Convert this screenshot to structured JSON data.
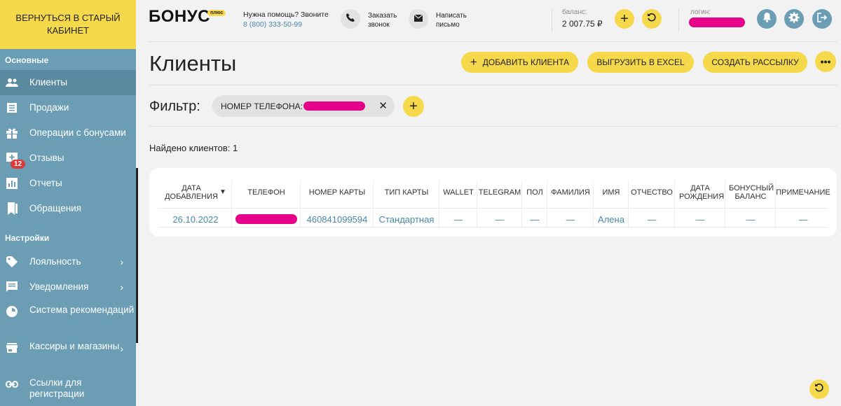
{
  "sidebar": {
    "back_button": "ВЕРНУТЬСЯ В СТАРЫЙ КАБИНЕТ",
    "section_main": "Основные",
    "section_settings": "Настройки",
    "items": [
      {
        "label": "Клиенты",
        "icon": "people-icon"
      },
      {
        "label": "Продажи",
        "icon": "receipt-icon"
      },
      {
        "label": "Операции с бонусами",
        "icon": "gift-icon"
      },
      {
        "label": "Отзывы",
        "icon": "review-icon",
        "badge": "12"
      },
      {
        "label": "Отчеты",
        "icon": "chart-icon"
      },
      {
        "label": "Обращения",
        "icon": "bookmark-icon"
      },
      {
        "label": "Лояльность",
        "icon": "tag-icon"
      },
      {
        "label": "Уведомления",
        "icon": "message-icon"
      },
      {
        "label": "Система рекомендаций",
        "icon": "disc-icon"
      },
      {
        "label": "Кассиры и магазины",
        "icon": "store-icon"
      },
      {
        "label": "Ссылки для регистрации",
        "icon": "link-icon"
      }
    ]
  },
  "header": {
    "logo": "БОНУС",
    "logo_badge": "плюс",
    "help_text": "Нужна помощь? Звоните",
    "help_phone": "8 (800) 333-50-99",
    "call_label_1": "Заказать",
    "call_label_2": "звонок",
    "mail_label_1": "Написать",
    "mail_label_2": "письмо",
    "balance_label": "баланс:",
    "balance_value": "2 007.75 ₽",
    "login_label": "логин:"
  },
  "main": {
    "title": "Клиенты",
    "add_client": "ДОБАВИТЬ КЛИЕНТА",
    "export_excel": "ВЫГРУЗИТЬ В EXCEL",
    "create_mailing": "СОЗДАТЬ РАССЫЛКУ",
    "filter_label": "Фильтр:",
    "filter_chip": "НОМЕР ТЕЛЕФОНА:",
    "found_text": "Найдено клиентов: 1"
  },
  "table": {
    "headers": {
      "date": "ДАТА ДОБАВЛЕНИЯ",
      "phone": "ТЕЛЕФОН",
      "card_number": "НОМЕР КАРТЫ",
      "card_type": "ТИП КАРТЫ",
      "wallet": "WALLET",
      "telegram": "TELEGRAM",
      "gender": "ПОЛ",
      "last_name": "ФАМИЛИЯ",
      "first_name": "ИМЯ",
      "patronymic": "ОТЧЕСТВО",
      "birthdate": "ДАТА РОЖДЕНИЯ",
      "bonus_balance": "БОНУСНЫЙ БАЛАНС",
      "note": "ПРИМЕЧАНИЕ"
    },
    "row": {
      "date": "26.10.2022",
      "card_number": "460841099594",
      "card_type": "Стандартная",
      "wallet": "—",
      "telegram": "—",
      "gender": "—",
      "last_name": "—",
      "first_name": "Алена",
      "patronymic": "—",
      "birthdate": "—",
      "bonus_balance": "—",
      "note": "—"
    }
  },
  "colors": {
    "accent_yellow": "#f5d94a",
    "sidebar": "#6b9eb5",
    "link": "#4a8aa8",
    "redaction": "#e60089"
  }
}
